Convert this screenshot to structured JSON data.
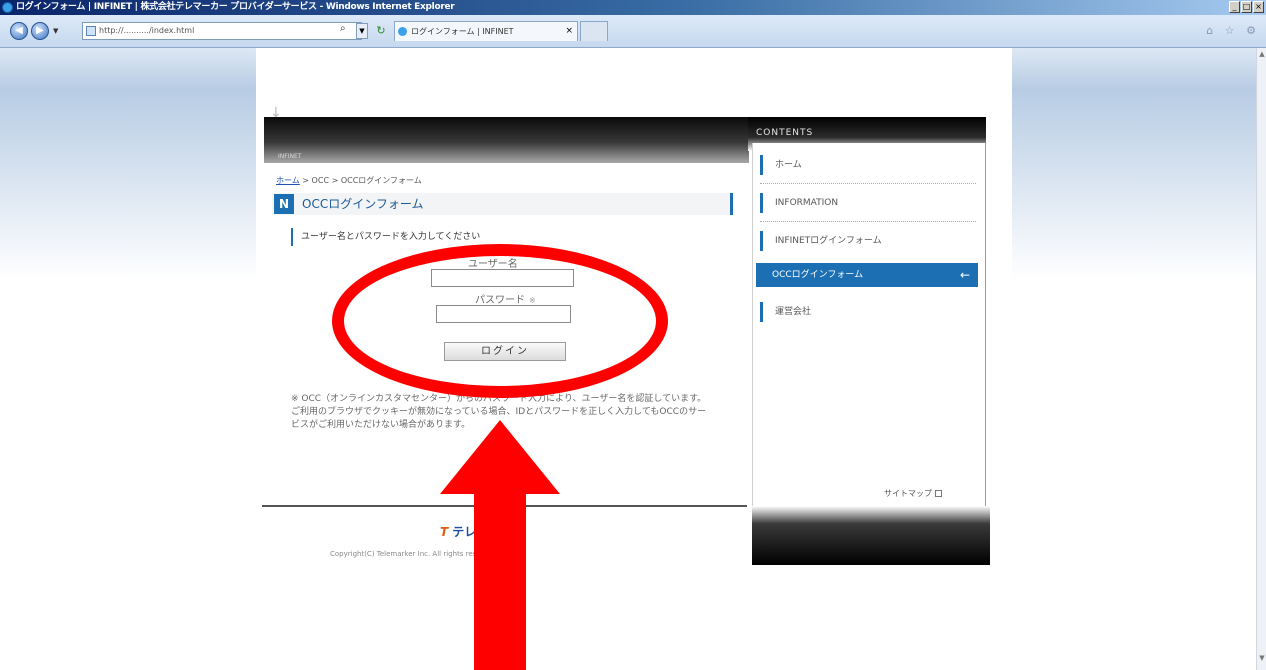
{
  "window": {
    "title": "ログインフォーム | INFINET | 株式会社テレマーカー プロバイダーサービス - Windows Internet Explorer",
    "controls": [
      "_",
      "□",
      "×"
    ]
  },
  "browser": {
    "address": "http://........../index.html",
    "tab_title": "ログインフォーム | INFINET",
    "tab_close": "×",
    "search_glyph": "⌕",
    "right_icons": "⌂ ☆ ⚙"
  },
  "page": {
    "header_sub": "INFINET",
    "breadcrumb_home": "ホーム",
    "breadcrumb_rest": " > OCC > OCCログインフォーム",
    "heading_badge": "N",
    "heading": "OCCログインフォーム",
    "instruction": "ユーザー名とパスワードを入力してください",
    "username_label": "ユーザー名",
    "password_label": "パスワード",
    "password_mark": "※",
    "login_button": "ログイン",
    "note": "※ OCC（オンラインカスタマセンター）からのパスワード入力により、ユーザー名を認証しています。ご利用のブラウザでクッキーが無効になっている場合、IDとパスワードを正しく入力してもOCCのサービスがご利用いただけない場合があります。",
    "footer_logo": "テレマーカー",
    "copyright": "Copyright(C) Telemarker Inc. All rights reserved."
  },
  "sidebar": {
    "title": "CONTENTS",
    "items": [
      {
        "label": "ホーム"
      },
      {
        "label": "INFORMATION"
      },
      {
        "label": "INFINETログインフォーム"
      },
      {
        "label": "OCCログインフォーム"
      },
      {
        "label": "運営会社"
      }
    ],
    "sitemap": "サイトマップ"
  },
  "colors": {
    "accent": "#1c6fb3",
    "annotation": "#ff0000"
  }
}
